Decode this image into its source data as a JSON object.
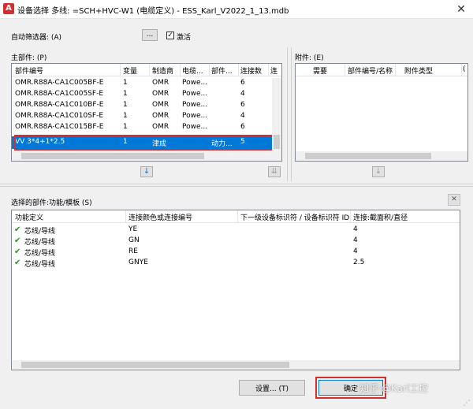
{
  "window": {
    "title": "设备选择 多线: =SCH+HVC-W1 (电缆定义) - ESS_Karl_V2022_1_13.mdb",
    "app_icon": "A",
    "close_symbol": "✕"
  },
  "filter": {
    "label": "自动筛选器: (A)",
    "browse_label": "...",
    "activate_label": "激活",
    "activate_checked": true
  },
  "main_parts": {
    "label": "主部件: (P)",
    "columns": [
      "部件编号",
      "变量",
      "制造商",
      "电缆...",
      "部件...",
      "连接数",
      "连"
    ],
    "rows": [
      [
        "OMR.R88A-CA1C005BF-E",
        "1",
        "OMR",
        "Powe...",
        "",
        "6"
      ],
      [
        "OMR.R88A-CA1C005SF-E",
        "1",
        "OMR",
        "Powe...",
        "",
        "4"
      ],
      [
        "OMR.R88A-CA1C010BF-E",
        "1",
        "OMR",
        "Powe...",
        "",
        "6"
      ],
      [
        "OMR.R88A-CA1C010SF-E",
        "1",
        "OMR",
        "Powe...",
        "",
        "4"
      ],
      [
        "OMR.R88A-CA1C015BF-E",
        "1",
        "OMR",
        "Powe...",
        "",
        "6"
      ],
      [
        "VV 3*4+1*2.5",
        "1",
        "津成",
        "",
        "动力...",
        "5"
      ]
    ],
    "selected_row": 5
  },
  "accessories": {
    "label": "附件: (E)",
    "columns": [
      "需要",
      "部件编号/名称",
      "附件类型",
      "("
    ]
  },
  "functions": {
    "label": "选择的部件:功能/模板 (S)",
    "close_symbol": "✕",
    "columns": [
      "功能定义",
      "连接颜色或连接编号",
      "下一级设备标识符 / 设备标识符 ID",
      "连接:截面积/直径"
    ],
    "rows": [
      [
        "芯线/导线",
        "YE",
        "",
        "4"
      ],
      [
        "芯线/导线",
        "GN",
        "",
        "4"
      ],
      [
        "芯线/导线",
        "RE",
        "",
        "4"
      ],
      [
        "芯线/导线",
        "GNYE",
        "",
        "2.5"
      ]
    ]
  },
  "buttons": {
    "settings": "设置... (T)",
    "ok": "确定"
  },
  "watermark": "知乎 @Karl工控"
}
